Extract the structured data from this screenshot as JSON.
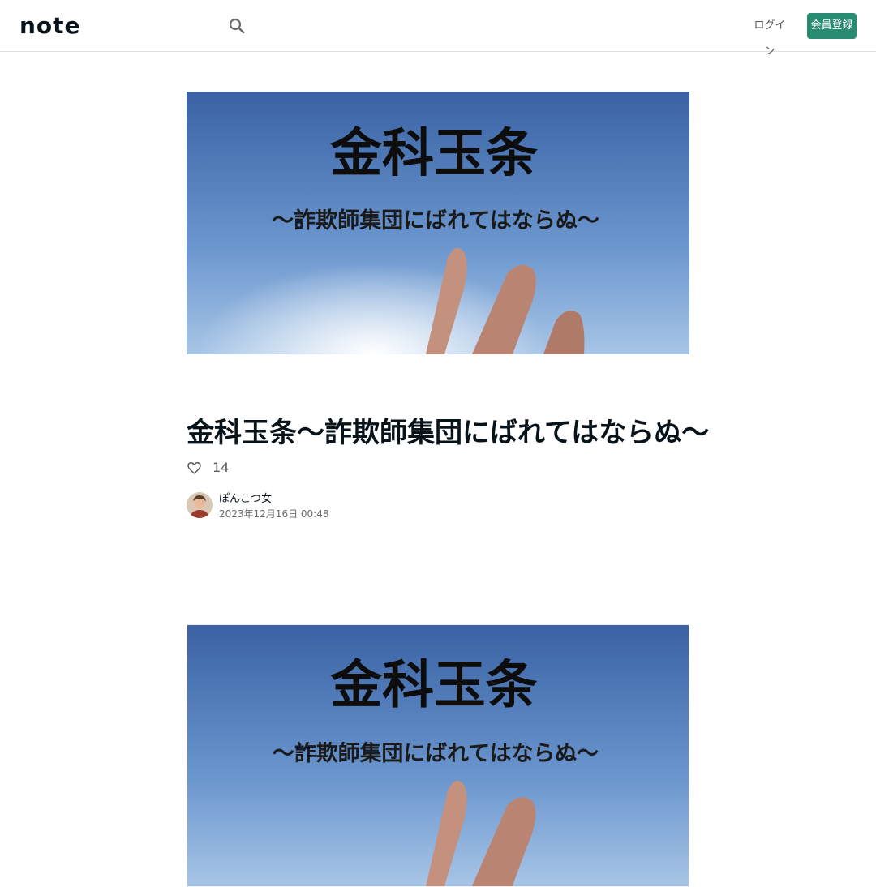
{
  "header": {
    "logo_text": "note",
    "search_icon": "search-icon",
    "login_label": "ログイン",
    "signup_label": "会員登録"
  },
  "eyecatch": {
    "image_title": "金科玉条",
    "image_subtitle": "～詐欺師集団にばれてはならぬ～"
  },
  "article": {
    "title": "金科玉条～詐欺師集団にばれてはならぬ～",
    "like_icon": "heart-icon",
    "like_count": "14",
    "author_name": "ぽんこつ女",
    "post_date": "2023年12月16日 00:48"
  },
  "body_image": {
    "image_title": "金科玉条",
    "image_subtitle": "～詐欺師集団にばれてはならぬ～"
  },
  "colors": {
    "accent": "#2a8b73",
    "text": "#08131a",
    "sky_top": "#2f5a9c",
    "sky_bottom": "#7ba7d8"
  }
}
